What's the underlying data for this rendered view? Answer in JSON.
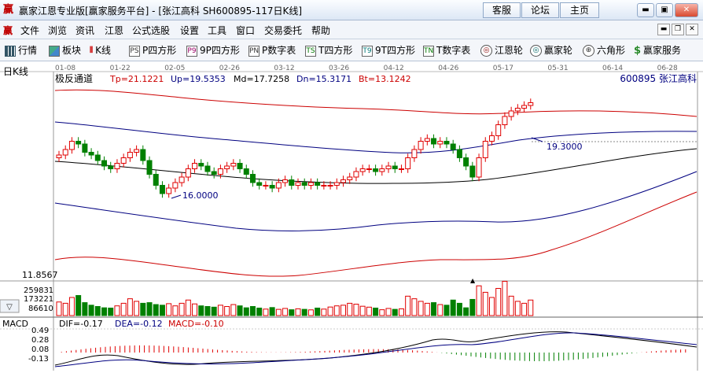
{
  "window": {
    "logo": "赢",
    "title": "赢家江恩专业版[赢家服务平台] - [张江高科  SH600895-117日K线]",
    "top_buttons": [
      "客服",
      "论坛",
      "主页"
    ]
  },
  "menu": {
    "logo": "赢",
    "items": [
      "文件",
      "浏览",
      "资讯",
      "江恩",
      "公式选股",
      "设置",
      "工具",
      "窗口",
      "交易委托",
      "帮助"
    ]
  },
  "toolbar": {
    "items": [
      {
        "label": "行情",
        "icon": "grid-icon",
        "badge": ""
      },
      {
        "label": "板块",
        "icon": "sector-icon",
        "badge": ""
      },
      {
        "label": "K线",
        "icon": "candlestick-icon",
        "badge": ""
      },
      {
        "label": "P四方形",
        "icon": "p-square-icon",
        "badge": "PS"
      },
      {
        "label": "9P四方形",
        "icon": "9p-square-icon",
        "badge": "P9"
      },
      {
        "label": "P数字表",
        "icon": "p-number-table-icon",
        "badge": "PN"
      },
      {
        "label": "T四方形",
        "icon": "t-square-icon",
        "badge": "TS"
      },
      {
        "label": "9T四方形",
        "icon": "9t-square-icon",
        "badge": "T9"
      },
      {
        "label": "T数字表",
        "icon": "t-number-table-icon",
        "badge": "TN"
      },
      {
        "label": "江恩轮",
        "icon": "gann-wheel-icon",
        "badge": "◎"
      },
      {
        "label": "赢家轮",
        "icon": "winner-wheel-icon",
        "badge": "◎"
      },
      {
        "label": "六角形",
        "icon": "hexagon-icon",
        "badge": "⊕"
      },
      {
        "label": "赢家服务",
        "icon": "dollar-icon",
        "badge": "$"
      }
    ]
  },
  "chart": {
    "period_label": "日K线",
    "stock": "600895 张江高科",
    "date_ticks": [
      "01-08",
      "01-22",
      "02-05",
      "02-26",
      "03-12",
      "03-26",
      "04-12",
      "04-26",
      "05-17",
      "05-31",
      "06-14",
      "06-28"
    ],
    "indicator": {
      "name": "极反通道",
      "params": [
        {
          "label": "Tp=21.1221",
          "color": "#cc0000"
        },
        {
          "label": "Up=19.5353",
          "color": "#000080"
        },
        {
          "label": "Md=17.7258",
          "color": "#000000"
        },
        {
          "label": "Dn=15.3171",
          "color": "#000080"
        },
        {
          "label": "Bt=13.1242",
          "color": "#cc0000"
        }
      ]
    },
    "annotations": {
      "high": "19.3000",
      "low": "16.0000"
    },
    "vol_axis": [
      "11.8567",
      "259831",
      "173221",
      "86610"
    ],
    "macd": {
      "name": "MACD",
      "dif": "DIF=-0.17",
      "dea": "DEA=-0.12",
      "macd": "MACD=-0.10",
      "axis": [
        "0.49",
        "0.28",
        "0.08",
        "-0.13"
      ]
    },
    "colors": {
      "up": "#e00000",
      "down": "#008000",
      "top": "#cc0000",
      "band": "#000080",
      "mid": "#000000"
    }
  },
  "chart_data": {
    "type": "candlestick",
    "title": "张江高科 SH600895 日K线",
    "date_range": [
      "01-08",
      "06-28"
    ],
    "indicator": "极反通道",
    "channels": {
      "Tp": 21.1221,
      "Up": 19.5353,
      "Md": 17.7258,
      "Dn": 15.3171,
      "Bt": 13.1242
    },
    "annotated_high": 19.3,
    "annotated_low": 16.0,
    "closes": [
      17.4,
      17.6,
      17.9,
      17.8,
      17.5,
      17.4,
      17.2,
      17.0,
      16.9,
      17.1,
      17.3,
      17.5,
      17.6,
      17.2,
      16.7,
      16.3,
      16.0,
      16.2,
      16.4,
      16.6,
      16.9,
      17.1,
      17.0,
      16.8,
      16.7,
      16.9,
      17.0,
      17.1,
      16.9,
      16.7,
      16.4,
      16.3,
      16.3,
      16.2,
      16.4,
      16.5,
      16.3,
      16.4,
      16.3,
      16.4,
      16.3,
      16.3,
      16.3,
      16.4,
      16.5,
      16.6,
      16.8,
      16.9,
      16.9,
      16.8,
      16.9,
      17.0,
      16.9,
      16.9,
      17.3,
      17.6,
      17.9,
      18.0,
      17.8,
      17.9,
      17.8,
      17.6,
      17.3,
      17.0,
      16.6,
      17.3,
      17.9,
      18.1,
      18.5,
      18.8,
      19.0,
      19.1,
      19.2,
      19.3
    ],
    "volumes": [
      105000,
      95000,
      140000,
      155000,
      100000,
      80000,
      70000,
      60000,
      58000,
      75000,
      95000,
      130000,
      110000,
      95000,
      100000,
      85000,
      80000,
      92000,
      75000,
      95000,
      120000,
      90000,
      75000,
      70000,
      65000,
      80000,
      70000,
      85000,
      75000,
      60000,
      70000,
      58000,
      50000,
      62000,
      48000,
      55000,
      45000,
      52000,
      48000,
      44000,
      58000,
      50000,
      66000,
      75000,
      80000,
      95000,
      88000,
      72000,
      65000,
      58000,
      45000,
      55000,
      48000,
      52000,
      150000,
      130000,
      110000,
      95000,
      100000,
      85000,
      80000,
      120000,
      95000,
      60000,
      125000,
      230000,
      180000,
      140000,
      210000,
      265000,
      150000,
      110000,
      95000,
      120000
    ],
    "macd": {
      "DIF": -0.17,
      "DEA": -0.12,
      "MACD": -0.1,
      "ylim": [
        -0.13,
        0.49
      ]
    }
  }
}
